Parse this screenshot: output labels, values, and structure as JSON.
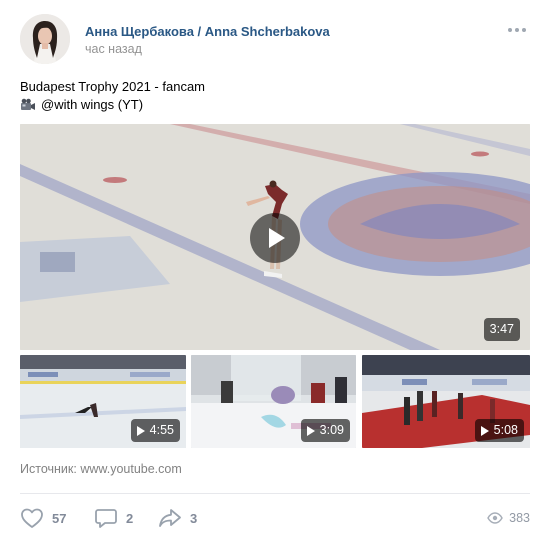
{
  "post": {
    "author": "Анна Щербакова / Anna Shcherbakova",
    "time": "час назад",
    "text_line1": "Budapest Trophy 2021 - fancam",
    "text_line2": "@with wings (YT)",
    "icons": {
      "avatar": "avatar-photo",
      "more": "more-dots-icon",
      "camera": "video-camera-emoji-icon"
    }
  },
  "videos": {
    "main": {
      "duration": "3:47"
    },
    "thumbs": [
      {
        "duration": "4:55"
      },
      {
        "duration": "3:09"
      },
      {
        "duration": "5:08"
      }
    ]
  },
  "source": {
    "label": "Источник:",
    "link": "www.youtube.com"
  },
  "actions": {
    "likes": "57",
    "comments": "2",
    "shares": "3",
    "views": "383"
  },
  "colors": {
    "author_link": "#2a5885",
    "muted": "#828a99",
    "divider": "#e7e8ec"
  }
}
